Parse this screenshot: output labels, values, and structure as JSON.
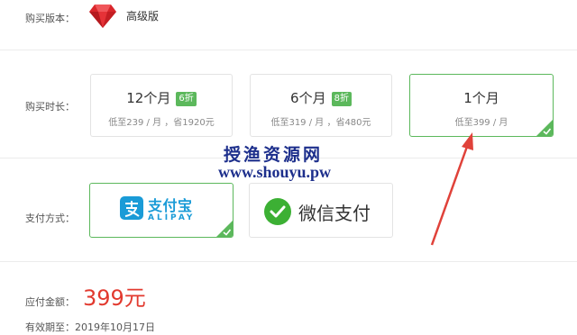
{
  "edition": {
    "label": "购买版本：",
    "name": "高级版",
    "icon": "ruby-gem-icon"
  },
  "duration": {
    "label": "购买时长：",
    "plans": [
      {
        "title": "12个月",
        "badge": "6折",
        "sub": "低至239 / 月 ，省1920元",
        "selected": false
      },
      {
        "title": "6个月",
        "badge": "8折",
        "sub": "低至319 / 月 ，省480元",
        "selected": false
      },
      {
        "title": "1个月",
        "badge": "",
        "sub": "低至399 / 月",
        "selected": true
      }
    ]
  },
  "watermark": {
    "cn": "授渔资源网",
    "url": "www.shouyu.pw"
  },
  "payment": {
    "label": "支付方式：",
    "alipay": {
      "name": "支付宝",
      "sub": "ALIPAY",
      "selected": true
    },
    "wechat": {
      "name": "微信支付",
      "selected": false
    }
  },
  "amount": {
    "label": "应付金额：",
    "value": "399元"
  },
  "validity": {
    "label": "有效期至：",
    "date": "2019年10月17日"
  },
  "colors": {
    "accent": "#5cb85c",
    "price": "#e23a2f",
    "alipay": "#1a9bd7",
    "wechat": "#3cb034",
    "arrow": "#e0423a"
  }
}
